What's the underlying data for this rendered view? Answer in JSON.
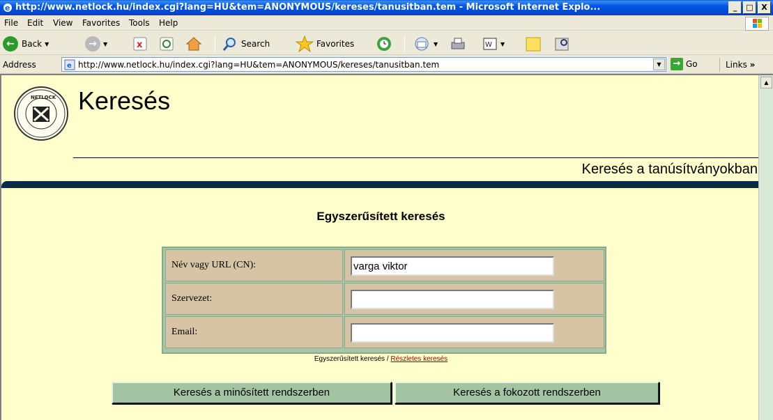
{
  "window": {
    "title": "http://www.netlock.hu/index.cgi?lang=HU&tem=ANONYMOUS/kereses/tanusitban.tem - Microsoft Internet Explo...",
    "buttons": [
      "_",
      "□",
      "X"
    ]
  },
  "menu": [
    "File",
    "Edit",
    "View",
    "Favorites",
    "Tools",
    "Help"
  ],
  "toolbar": {
    "back_label": "Back",
    "search_label": "Search",
    "favorites_label": "Favorites"
  },
  "address": {
    "label": "Address",
    "url": "http://www.netlock.hu/index.cgi?lang=HU&tem=ANONYMOUS/kereses/tanusitban.tem",
    "go_label": "Go",
    "links_label": "Links"
  },
  "page": {
    "title": "Keresés",
    "subtitle": "Keresés a tanúsítványokban",
    "form_title": "Egyszerűsített keresés",
    "fields": [
      {
        "label": "Név vagy URL (CN):",
        "value": "varga viktor"
      },
      {
        "label": "Szervezet:",
        "value": ""
      },
      {
        "label": "Email:",
        "value": ""
      }
    ],
    "mode_current": "Egyszerűsített keresés /",
    "mode_link": "Részletes keresés",
    "buttons": [
      "Keresés a minősített rendszerben",
      "Keresés a fokozott rendszerben"
    ]
  },
  "colors": {
    "page_bg": "#ffffcc",
    "table_cell": "#d6c4a4",
    "button": "#a3c5a3",
    "nav_stripe": "#0b2a4a"
  }
}
